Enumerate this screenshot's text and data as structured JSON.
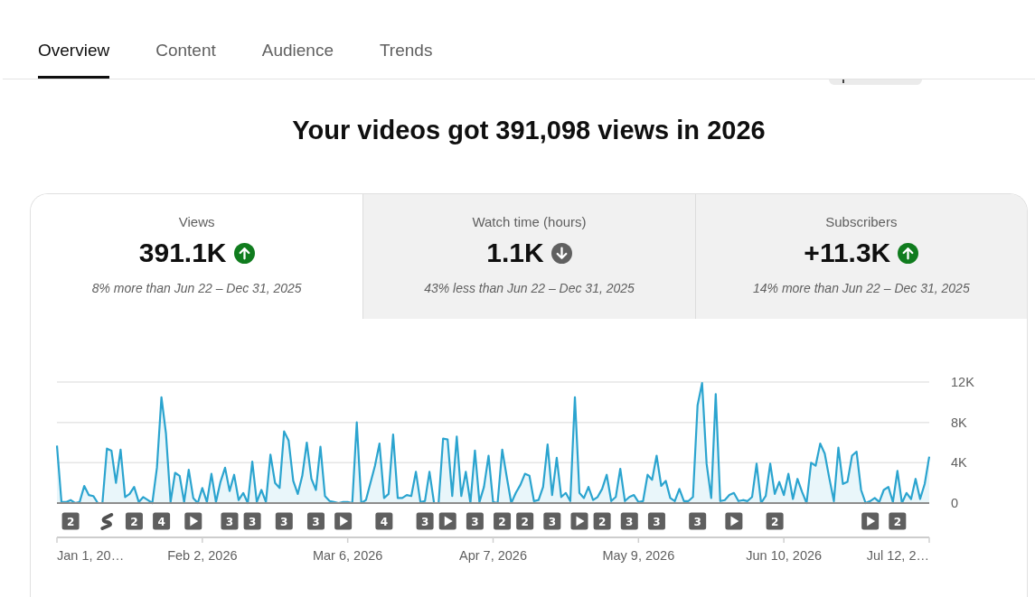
{
  "tabs": [
    {
      "label": "Overview",
      "selected": true
    },
    {
      "label": "Content",
      "selected": false
    },
    {
      "label": "Audience",
      "selected": false
    },
    {
      "label": "Trends",
      "selected": false
    }
  ],
  "headline": "Your videos got 391,098 views in 2026",
  "metrics": [
    {
      "title": "Views",
      "value": "391.1K",
      "kind": "up",
      "comparison": "8% more than Jun 22 – Dec 31, 2025",
      "selected": true
    },
    {
      "title": "Watch time (hours)",
      "value": "1.1K",
      "kind": "down",
      "comparison": "43% less than Jun 22 – Dec 31, 2025",
      "selected": false
    },
    {
      "title": "Subscribers",
      "value": "+11.3K",
      "kind": "up",
      "comparison": "14% more than Jun 22 – Dec 31, 2025",
      "selected": false
    }
  ],
  "chart": {
    "chart_data": {
      "type": "area",
      "categories": [
        null,
        null,
        null,
        null,
        null,
        null,
        null,
        null,
        null,
        null,
        null,
        null,
        null,
        null,
        null,
        null,
        null,
        null,
        null,
        null,
        null,
        null,
        null,
        null,
        null,
        null,
        null,
        null,
        null,
        null,
        null,
        null,
        "Feb 2, 2026",
        null,
        null,
        null,
        null,
        null,
        null,
        null,
        null,
        null,
        null,
        null,
        null,
        null,
        null,
        null,
        null,
        null,
        null,
        null,
        null,
        null,
        null,
        null,
        null,
        null,
        null,
        null,
        null,
        null,
        null,
        null,
        "Mar 6, 2026",
        null,
        null,
        null,
        null,
        null,
        null,
        null,
        null,
        null,
        null,
        null,
        null,
        null,
        null,
        null,
        null,
        null,
        null,
        null,
        null,
        null,
        null,
        null,
        null,
        null,
        null,
        null,
        null,
        null,
        null,
        null,
        "Apr 7, 2026",
        null,
        null,
        null,
        null,
        null,
        null,
        null,
        null,
        null,
        null,
        null,
        null,
        null,
        null,
        null,
        null,
        null,
        null,
        null,
        null,
        null,
        null,
        null,
        null,
        null,
        null,
        null,
        null,
        null,
        null,
        null,
        "May 9, 2026",
        null,
        null,
        null,
        null,
        null,
        null,
        null,
        null,
        null,
        null,
        null,
        null,
        null,
        null,
        null,
        null,
        null,
        null,
        null,
        null,
        null,
        null,
        null,
        null,
        null,
        null,
        null,
        null,
        null,
        null,
        null,
        "Jun 10, 2026",
        null,
        null,
        null,
        null,
        null,
        null,
        null,
        null,
        null,
        null,
        null,
        null,
        null,
        null,
        null,
        null,
        null,
        null,
        null,
        null,
        null,
        null,
        null,
        null,
        null,
        null,
        null,
        null,
        null,
        null,
        null,
        null
      ],
      "ylim": [
        0,
        12000
      ],
      "yticks": [
        {
          "value": 0,
          "label": "0"
        },
        {
          "value": 4000,
          "label": "4K"
        },
        {
          "value": 8000,
          "label": "8K"
        },
        {
          "value": 12000,
          "label": "12K"
        }
      ],
      "series": [
        {
          "color": "#2ba4cf",
          "values": [
            5700,
            100,
            100,
            300,
            0,
            100,
            1700,
            800,
            700,
            0,
            0,
            5400,
            5200,
            2000,
            5300,
            600,
            900,
            1600,
            100,
            600,
            300,
            0,
            3500,
            10500,
            6900,
            100,
            3000,
            2700,
            100,
            3300,
            500,
            0,
            1500,
            100,
            2900,
            100,
            2100,
            3500,
            1200,
            2800,
            300,
            1000,
            0,
            4100,
            100,
            1300,
            100,
            4800,
            2000,
            1500,
            7100,
            6200,
            2200,
            900,
            2700,
            6000,
            2400,
            1300,
            5600,
            700,
            200,
            100,
            0,
            100,
            100,
            0,
            8000,
            0,
            300,
            2000,
            3700,
            5900,
            500,
            900,
            6800,
            500,
            500,
            800,
            700,
            3100,
            100,
            200,
            3100,
            0,
            0,
            6400,
            6300,
            700,
            6600,
            700,
            3100,
            0,
            5200,
            100,
            1600,
            4700,
            100,
            0,
            5300,
            2600,
            0,
            1000,
            1800,
            2900,
            2700,
            200,
            300,
            1600,
            5800,
            800,
            4500,
            600,
            1000,
            200,
            10500,
            1000,
            500,
            1600,
            300,
            600,
            1400,
            2800,
            200,
            600,
            3400,
            200,
            600,
            800,
            100,
            200,
            2800,
            2300,
            4700,
            1700,
            2200,
            500,
            200,
            1400,
            200,
            200,
            600,
            9700,
            11900,
            3900,
            500,
            10800,
            200,
            300,
            800,
            1000,
            200,
            300,
            200,
            600,
            3900,
            0,
            700,
            3900,
            900,
            2100,
            800,
            2900,
            400,
            2400,
            1100,
            0,
            4000,
            3700,
            5900,
            4900,
            2500,
            200,
            5500,
            1900,
            2100,
            4700,
            5100,
            1300,
            0,
            200,
            500,
            100,
            1300,
            1600,
            100,
            3200,
            0,
            1000,
            400,
            2400,
            400,
            1900,
            4600
          ]
        }
      ]
    },
    "edge_labels": [
      "Jan 1, 20…",
      "Jul 12, 2…"
    ],
    "upload_markers": [
      {
        "kind": "count",
        "text": "2"
      },
      {
        "kind": "short"
      },
      {
        "kind": "count",
        "text": "2"
      },
      {
        "kind": "count",
        "text": "4"
      },
      {
        "kind": "video"
      },
      {
        "kind": "count",
        "text": "3"
      },
      {
        "kind": "count",
        "text": "3"
      },
      {
        "kind": "count",
        "text": "3"
      },
      {
        "kind": "count",
        "text": "3"
      },
      {
        "kind": "video"
      },
      {
        "kind": "count",
        "text": "4"
      },
      {
        "kind": "count",
        "text": "3"
      },
      {
        "kind": "video"
      },
      {
        "kind": "count",
        "text": "3"
      },
      {
        "kind": "count",
        "text": "2"
      },
      {
        "kind": "count",
        "text": "2"
      },
      {
        "kind": "count",
        "text": "3"
      },
      {
        "kind": "video"
      },
      {
        "kind": "count",
        "text": "2"
      },
      {
        "kind": "count",
        "text": "3"
      },
      {
        "kind": "count",
        "text": "3"
      },
      {
        "kind": "count",
        "text": "3"
      },
      {
        "kind": "video"
      },
      {
        "kind": "count",
        "text": "2"
      },
      {
        "kind": "video"
      },
      {
        "kind": "count",
        "text": "2"
      }
    ]
  }
}
